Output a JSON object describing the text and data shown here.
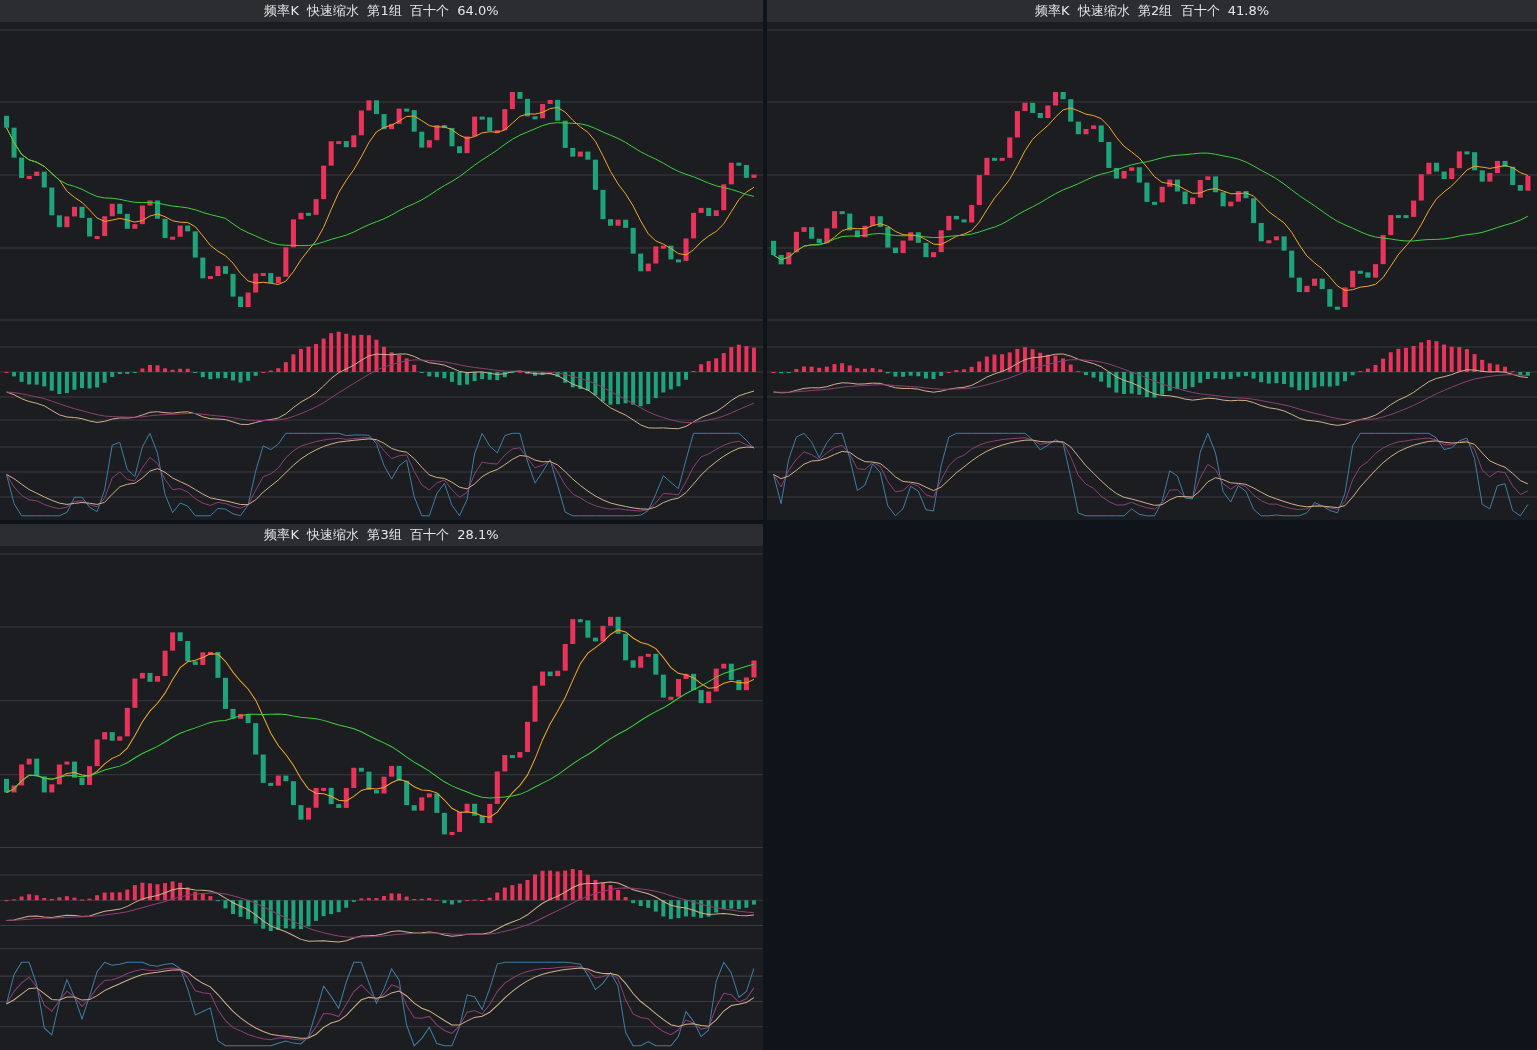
{
  "panels": [
    {
      "title": "频率K  快速缩水  第1组  百十个  64.0%"
    },
    {
      "title": "频率K  快速缩水  第2组  百十个  41.8%"
    },
    {
      "title": "频率K  快速缩水  第3组  百十个  28.1%"
    }
  ]
}
